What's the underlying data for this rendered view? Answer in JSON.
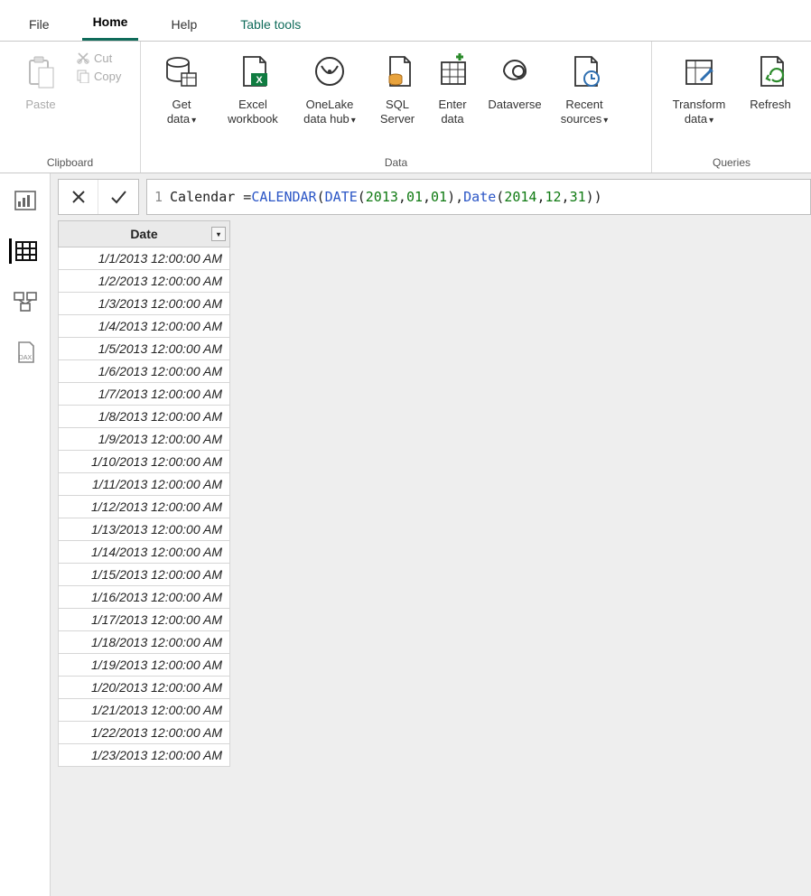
{
  "tabs": {
    "file": "File",
    "home": "Home",
    "help": "Help",
    "table_tools": "Table tools"
  },
  "ribbon": {
    "clipboard": {
      "group": "Clipboard",
      "paste": "Paste",
      "cut": "Cut",
      "copy": "Copy"
    },
    "data": {
      "group": "Data",
      "get_data": "Get\ndata",
      "excel": "Excel\nworkbook",
      "onelake": "OneLake\ndata hub",
      "sql": "SQL\nServer",
      "enter": "Enter\ndata",
      "dataverse": "Dataverse",
      "recent": "Recent\nsources"
    },
    "queries": {
      "group": "Queries",
      "transform": "Transform\ndata",
      "refresh": "Refresh"
    }
  },
  "formula": {
    "line_no": "1",
    "plain": "Calendar = ",
    "fn1": "CALENDAR",
    "fn2": "DATE",
    "fn3": "Date",
    "n1": "2013",
    "n2": "01",
    "n3": "01",
    "n4": "2014",
    "n5": "12",
    "n6": "31"
  },
  "grid": {
    "header": "Date",
    "rows": [
      "1/1/2013 12:00:00 AM",
      "1/2/2013 12:00:00 AM",
      "1/3/2013 12:00:00 AM",
      "1/4/2013 12:00:00 AM",
      "1/5/2013 12:00:00 AM",
      "1/6/2013 12:00:00 AM",
      "1/7/2013 12:00:00 AM",
      "1/8/2013 12:00:00 AM",
      "1/9/2013 12:00:00 AM",
      "1/10/2013 12:00:00 AM",
      "1/11/2013 12:00:00 AM",
      "1/12/2013 12:00:00 AM",
      "1/13/2013 12:00:00 AM",
      "1/14/2013 12:00:00 AM",
      "1/15/2013 12:00:00 AM",
      "1/16/2013 12:00:00 AM",
      "1/17/2013 12:00:00 AM",
      "1/18/2013 12:00:00 AM",
      "1/19/2013 12:00:00 AM",
      "1/20/2013 12:00:00 AM",
      "1/21/2013 12:00:00 AM",
      "1/22/2013 12:00:00 AM",
      "1/23/2013 12:00:00 AM"
    ]
  }
}
